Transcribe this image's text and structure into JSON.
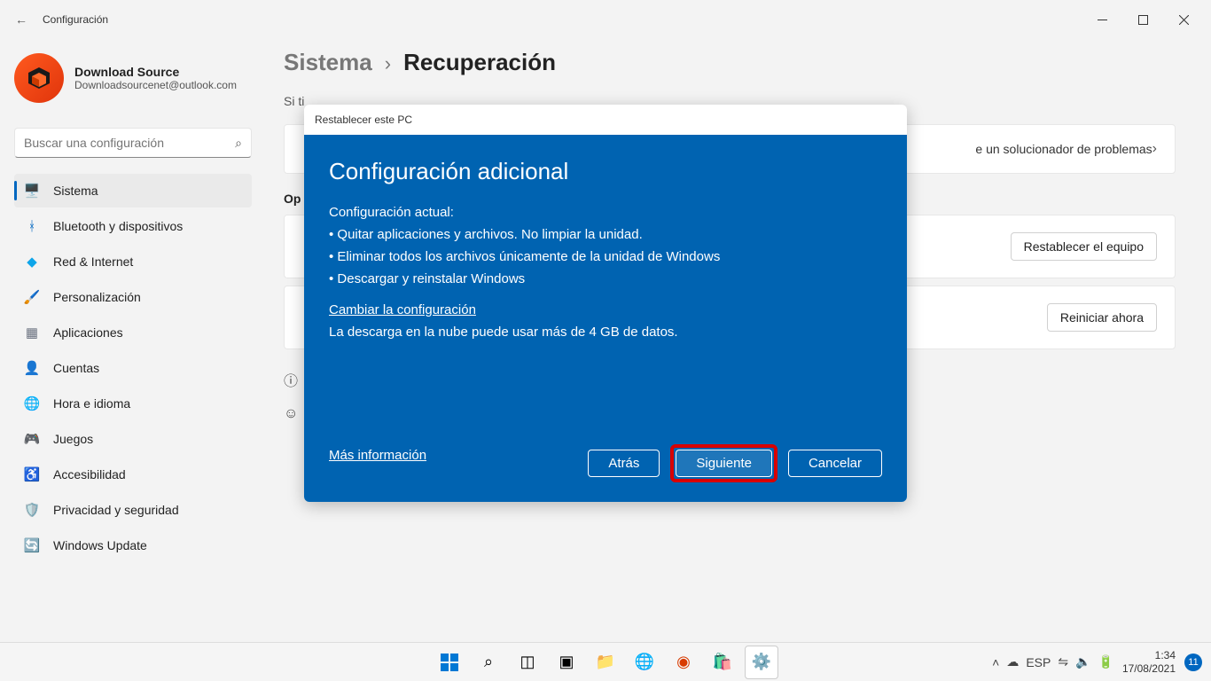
{
  "titlebar": {
    "back": "←",
    "title": "Configuración"
  },
  "user": {
    "name": "Download Source",
    "email": "Downloadsourcenet@outlook.com"
  },
  "search": {
    "placeholder": "Buscar una configuración"
  },
  "nav": [
    {
      "icon": "🖥️",
      "label": "Sistema",
      "active": true
    },
    {
      "icon": "ᚼ",
      "label": "Bluetooth y dispositivos",
      "icon_color": "#0067c0"
    },
    {
      "icon": "◆",
      "label": "Red & Internet",
      "icon_color": "#0ea5e9"
    },
    {
      "icon": "🖌️",
      "label": "Personalización"
    },
    {
      "icon": "▦",
      "label": "Aplicaciones",
      "icon_color": "#6b7280"
    },
    {
      "icon": "👤",
      "label": "Cuentas",
      "icon_color": "#10b981"
    },
    {
      "icon": "🌐",
      "label": "Hora e idioma"
    },
    {
      "icon": "🎮",
      "label": "Juegos"
    },
    {
      "icon": "♿",
      "label": "Accesibilidad",
      "icon_color": "#4f8be8"
    },
    {
      "icon": "🛡️",
      "label": "Privacidad y seguridad",
      "icon_color": "#9ca3af"
    },
    {
      "icon": "🔄",
      "label": "Windows Update",
      "icon_color": "#0067c0"
    }
  ],
  "breadcrumb": {
    "parent": "Sistema",
    "sep": "›",
    "current": "Recuperación"
  },
  "main": {
    "intro_prefix": "Si ti",
    "troubleshoot_suffix": "e un solucionador de problemas",
    "section": "Op",
    "reset_btn": "Restablecer el equipo",
    "restart_btn": "Reiniciar ahora"
  },
  "dialog": {
    "window_title": "Restablecer este PC",
    "heading": "Configuración adicional",
    "sub": "Configuración actual:",
    "items": [
      "• Quitar aplicaciones y archivos. No limpiar la unidad.",
      "• Eliminar todos los archivos únicamente de la unidad de Windows",
      "• Descargar y reinstalar Windows"
    ],
    "change_link": "Cambiar la configuración",
    "note": "La descarga en la nube puede usar más de 4 GB de datos.",
    "more": "Más información",
    "back": "Atrás",
    "next": "Siguiente",
    "cancel": "Cancelar"
  },
  "tray": {
    "lang": "ESP",
    "time": "1:34",
    "date": "17/08/2021",
    "badge": "11"
  }
}
